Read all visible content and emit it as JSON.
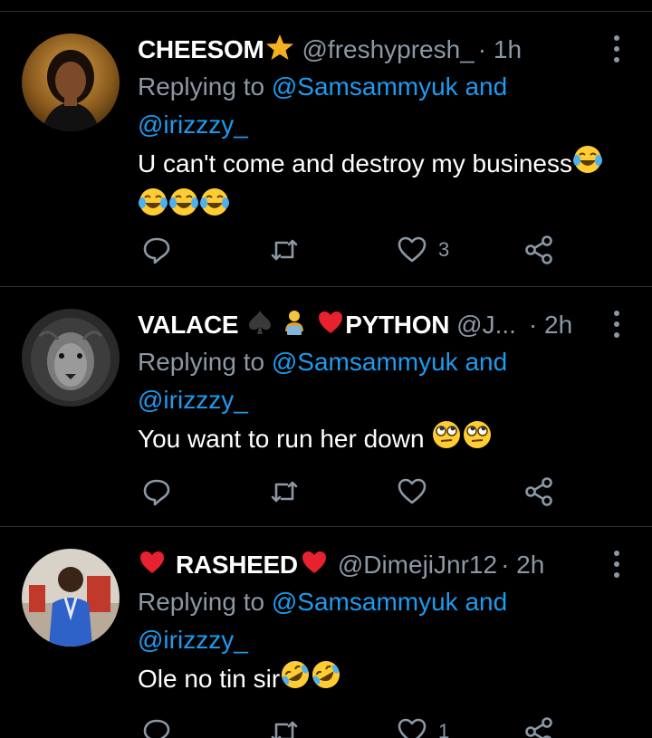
{
  "colors": {
    "background": "#000000",
    "text": "#ffffff",
    "muted": "#8b98a5",
    "link": "#1d9bf0",
    "divider": "#2f3336"
  },
  "tweets": [
    {
      "name": "CHEESOM",
      "name_emoji": "star-emoji",
      "handle": "@freshypresh_",
      "time": "· 1h",
      "replying_prefix": "Replying to ",
      "mention1": "@Samsammyuk",
      "conj": " and",
      "mention2": "@irizzzy_",
      "text": "U can't come and destroy my business",
      "text_emojis": [
        "tears-of-joy-emoji",
        "tears-of-joy-emoji",
        "tears-of-joy-emoji",
        "tears-of-joy-emoji"
      ],
      "reply_count": "",
      "retweet_count": "",
      "like_count": "3",
      "avatar_icon": "profile-photo-woman"
    },
    {
      "name_part1": "VALACE",
      "name_emojis": [
        "spade-suit-emoji",
        "technologist-emoji",
        "red-heart-emoji"
      ],
      "name_part2": "PYTHON",
      "handle": "@J...",
      "time": "· 2h",
      "replying_prefix": "Replying to ",
      "mention1": "@Samsammyuk",
      "conj": " and",
      "mention2": "@irizzzy_",
      "text": "You want to run her down",
      "text_emojis": [
        "rolling-eyes-emoji",
        "rolling-eyes-emoji"
      ],
      "reply_count": "",
      "retweet_count": "",
      "like_count": "",
      "avatar_icon": "profile-photo-lion"
    },
    {
      "name": "RASHEED",
      "name_emojis": [
        "red-heart-emoji",
        "red-heart-emoji"
      ],
      "handle": "@DimejiJnr12",
      "time": "· 2h",
      "replying_prefix": "Replying to ",
      "mention1": "@Samsammyuk",
      "conj": " and",
      "mention2": "@irizzzy_",
      "text": "Ole no tin sir",
      "text_emojis": [
        "rolling-laughing-emoji",
        "rolling-laughing-emoji"
      ],
      "reply_count": "",
      "retweet_count": "",
      "like_count": "1",
      "avatar_icon": "profile-photo-man"
    }
  ]
}
